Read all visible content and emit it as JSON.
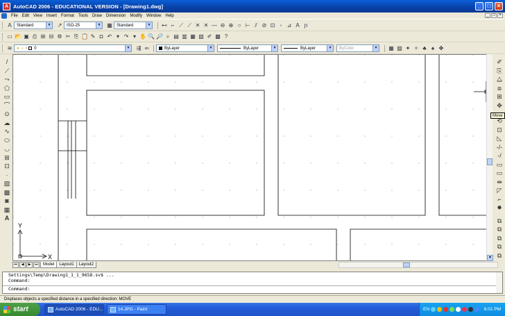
{
  "window": {
    "title": "AutoCAD 2006 - EDUCATIONAL VERSION - [Drawing1.dwg]",
    "app_icon": "A",
    "controls": [
      "_",
      "□",
      "×"
    ]
  },
  "menubar": {
    "items": [
      "File",
      "Edit",
      "View",
      "Insert",
      "Format",
      "Tools",
      "Draw",
      "Dimension",
      "Modify",
      "Window",
      "Help"
    ],
    "doc_controls": [
      "_",
      "□",
      "×"
    ]
  },
  "styles_toolbar": {
    "text_style": "Standard",
    "dim_style": "ISO-25",
    "table_style": "Standard"
  },
  "layers_toolbar": {
    "layer": "0",
    "color": "ByLayer",
    "linetype": "ByLayer",
    "lineweight": "ByLayer",
    "plotstyle": "ByColor"
  },
  "tooltip": {
    "text": "Move"
  },
  "ucs": {
    "y_label": "Y",
    "x_label": "X"
  },
  "layout_tabs": [
    "Model",
    "Layout1",
    "Layout2"
  ],
  "command_window": {
    "line1": "Settings\\Temp\\Drawing1_1_1_9658.sv$ ...",
    "line2": "Command:",
    "prompt": "Command:"
  },
  "statusbar": {
    "text": "Displaces objects a specified distance in a specified direction:  MOVE"
  },
  "taskbar": {
    "start_label": "start",
    "tasks": [
      "AutoCAD 2006 - EDU...",
      "14.JPG - Paint"
    ],
    "lang": "EN",
    "clock": "6:01 PM"
  }
}
